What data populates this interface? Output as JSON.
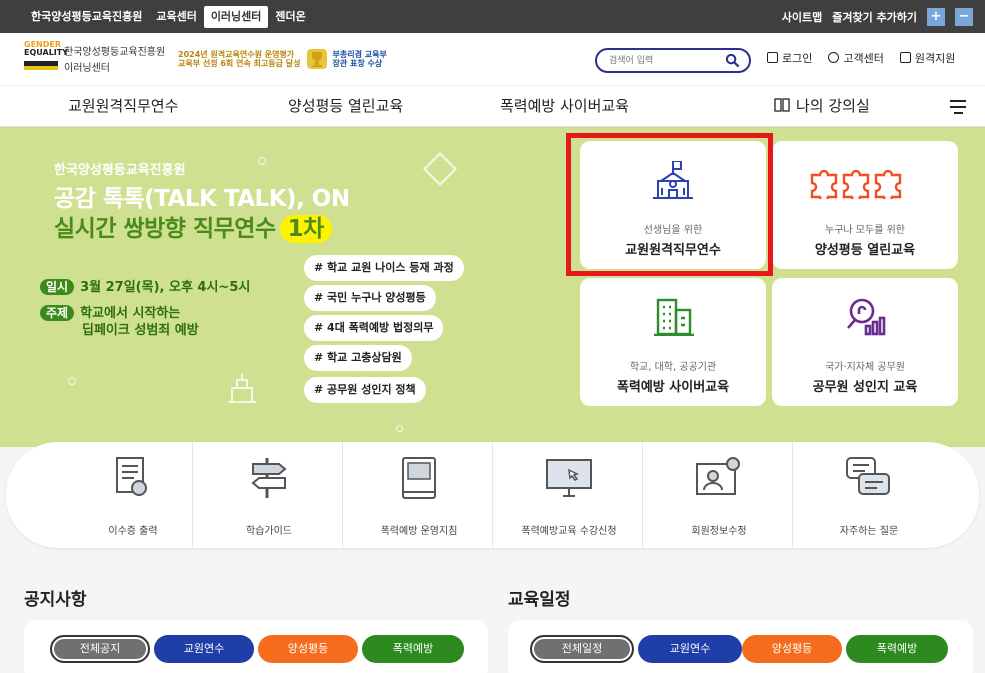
{
  "topbar": {
    "site_links": [
      "한국양성평등교육진흥원",
      "교육센터",
      "이러닝센터",
      "젠더온"
    ],
    "active_index": 2,
    "right_links": [
      "사이트맵",
      "즐겨찾기 추가하기"
    ],
    "zoom_in": "+",
    "zoom_out": "−"
  },
  "header": {
    "logo_en_1": "GENDER",
    "logo_en_2": "EQUALITY",
    "logo_org": "한국양성평등교육진흥원",
    "logo_center": "이러닝센터",
    "award_1_line1": "2024년 원격교육연수원 운영평가",
    "award_1_line2": "교육부 선정 6회 연속 최고등급 달성",
    "award_2_line1": "부총리겸 교육부",
    "award_2_line2": "장관 표창 수상",
    "search_placeholder": "검색어 입력",
    "links": [
      "로그인",
      "고객센터",
      "원격지원"
    ]
  },
  "gnb": {
    "items": [
      "교원원격직무연수",
      "양성평등 열린교육",
      "폭력예방 사이버교육",
      "나의 강의실"
    ]
  },
  "hero": {
    "org": "한국양성평등교육진흥원",
    "headline_1": "공감 톡톡(TALK TALK), ON",
    "headline_2": "실시간 쌍방향 직무연수",
    "badge": "1차",
    "date_label": "일시",
    "date_value": "3월 27일(목), 오후 4시~5시",
    "topic_label": "주제",
    "topic_line1": "학교에서 시작하는",
    "topic_line2": "딥페이크 성범죄 예방",
    "tags": [
      "# 학교 교원 나이스 등재 과정",
      "# 국민 누구나 양성평등",
      "# 4대 폭력예방 법정의무",
      "# 학교 고충상담원",
      "# 공무원 성인지 정책"
    ]
  },
  "cards": [
    {
      "sub": "선생님을 위한",
      "title": "교원원격직무연수",
      "icon": "school-icon",
      "color": "#2b43b3"
    },
    {
      "sub": "누구나 모두를 위한",
      "title": "양성평등 열린교육",
      "icon": "puzzle-icon",
      "color": "#f04e23"
    },
    {
      "sub": "학교, 대학, 공공기관",
      "title": "폭력예방 사이버교육",
      "icon": "building-icon",
      "color": "#2f8c2a"
    },
    {
      "sub": "국가·지자체 공무원",
      "title": "공무원 성인지 교육",
      "icon": "magnifier-chart-icon",
      "color": "#6a2c91"
    }
  ],
  "quick_menu": [
    "이수증 출력",
    "학습가이드",
    "폭력예방 운영지침",
    "폭력예방교육 수강신청",
    "회원정보수정",
    "자주하는 질문"
  ],
  "notice": {
    "title": "공지사항",
    "tabs": [
      "전체공지",
      "교원연수",
      "양성평등",
      "폭력예방"
    ]
  },
  "schedule": {
    "title": "교육일정",
    "tabs": [
      "전체일정",
      "교원연수",
      "양성평등",
      "폭력예방"
    ]
  }
}
